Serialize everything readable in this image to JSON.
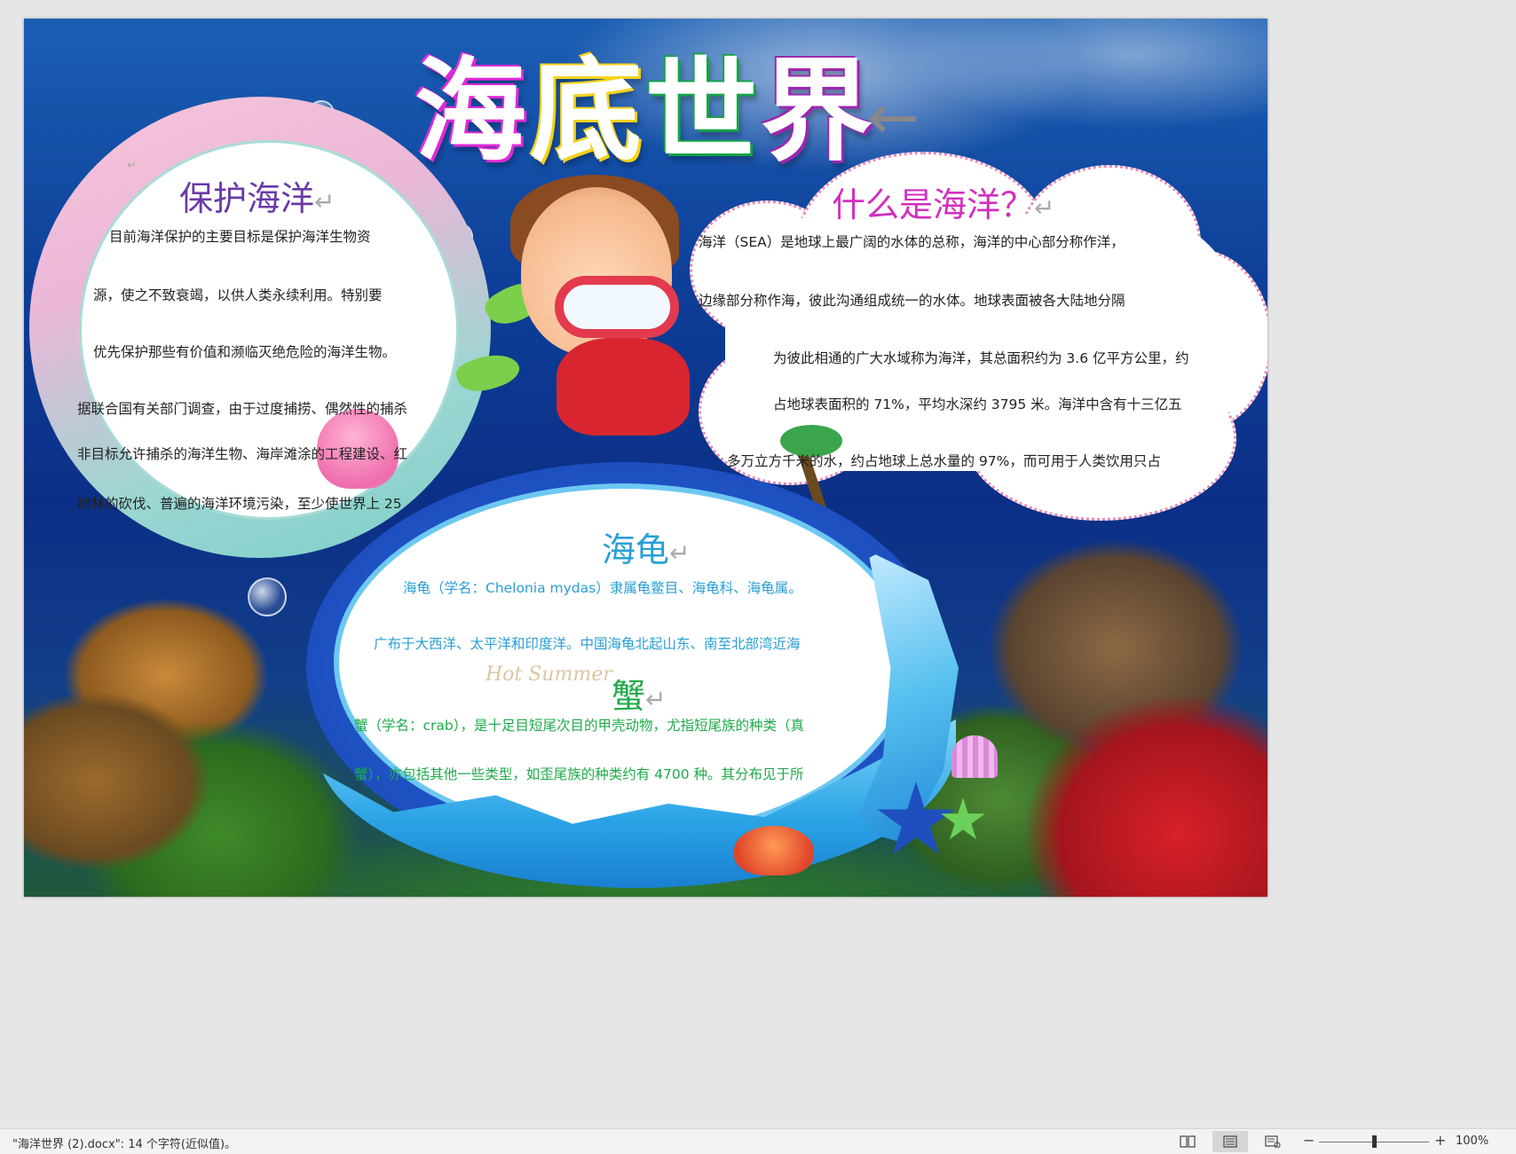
{
  "document": {
    "title": "海底世界",
    "title_chars": [
      "海",
      "底",
      "世",
      "界"
    ],
    "title_mark": "←",
    "left_panel": {
      "heading": "保护海洋",
      "heading_mark": "↵",
      "top_mark": "↵",
      "lines": [
        "目前海洋保护的主要目标是保护海洋生物资",
        "源，使之不致衰竭，以供人类永续利用。特别要",
        "优先保护那些有价值和濒临灭绝危险的海洋生物。",
        "据联合国有关部门调查，由于过度捕捞、偶然性的捕杀",
        "非目标允许捕杀的海洋生物、海岸滩涂的工程建设、红",
        "树林的砍伐、普遍的海洋环境污染，至少使世界上 25"
      ]
    },
    "right_panel": {
      "heading": "什么是海洋？",
      "heading_mark": "↵",
      "lines": [
        "海洋（SEA）是地球上最广阔的水体的总称，海洋的中心部分称作洋，",
        "边缘部分称作海，彼此沟通组成统一的水体。地球表面被各大陆地分隔",
        "为彼此相通的广大水域称为海洋，其总面积约为 3.6 亿平方公里，约",
        "占地球表面积的 71%，平均水深约 3795 米。海洋中含有十三亿五",
        "多万立方千米的水，约占地球上总水量的 97%，而可用于人类饮用只占"
      ]
    },
    "turtle_panel": {
      "heading": "海龟",
      "heading_mark": "↵",
      "lines": [
        "海龟（学名：Chelonia mydas）隶属龟鳖目、海龟科、海龟属。",
        "广布于大西洋、太平洋和印度洋。中国海龟北起山东、南至北部湾近海"
      ]
    },
    "crab_panel": {
      "heading": "蟹",
      "heading_mark": "↵",
      "lines": [
        "蟹（学名：crab），是十足目短尾次目的甲壳动物，尤指短尾族的种类（真",
        "蟹），亦包括其他一些类型，如歪尾族的种类约有 4700 种。其分布见于所"
      ]
    },
    "decor_text": "Hot Summer"
  },
  "statusbar": {
    "doc_status": "\"海洋世界 (2).docx\": 14 个字符(近似值)。",
    "zoom_minus": "−",
    "zoom_plus": "+",
    "zoom_level": "100%",
    "zoom_fraction": 0.5,
    "active_view": "print-layout"
  },
  "colors": {
    "left_heading": "#6a3aa8",
    "right_heading": "#d12fbf",
    "turtle": "#2a9fd6",
    "crab": "#1faa4a"
  }
}
